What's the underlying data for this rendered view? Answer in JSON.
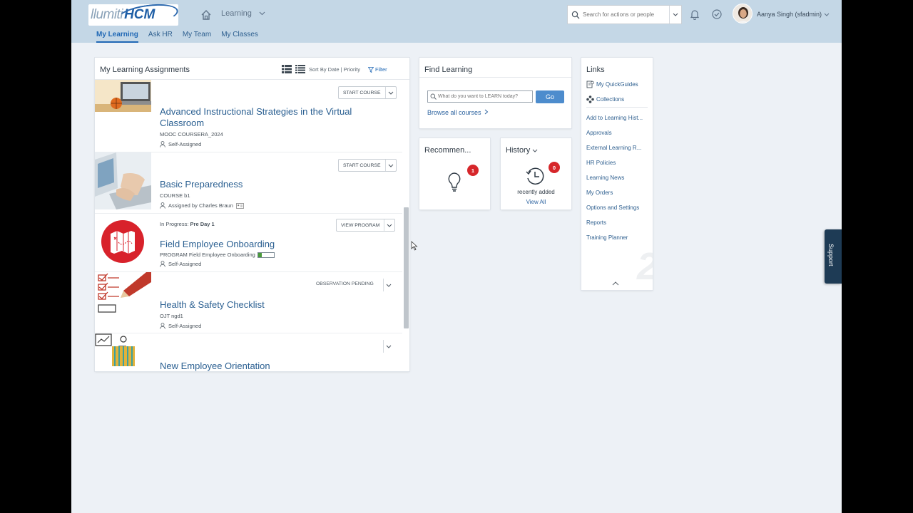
{
  "header": {
    "logo_text_a": "llumiti",
    "logo_text_b": "HCM",
    "module": "Learning",
    "search_placeholder": "Search for actions or people",
    "user_name": "Aanya Singh (sfadmin)",
    "subnav": [
      "My Learning",
      "Ask HR",
      "My Team",
      "My Classes"
    ]
  },
  "assignments": {
    "title": "My Learning Assignments",
    "sort_by_date": "Sort By Date",
    "sort_sep": " | ",
    "sort_priority": "Priority",
    "filter": "Filter",
    "items": [
      {
        "title": "Advanced Instructional Strategies in the Virtual Classroom",
        "meta": "MOOC COURSERA_2024",
        "assigned": "Self-Assigned",
        "action": "START COURSE"
      },
      {
        "title": "Basic Preparedness",
        "meta": "COURSE b1",
        "assigned": "Assigned by Charles Braun",
        "action": "START COURSE"
      },
      {
        "progress_label": "In Progress:",
        "progress_value": "Pre Day 1",
        "title": "Field Employee Onboarding",
        "meta": "PROGRAM Field Employee Onboarding",
        "progress_fraction": 0.25,
        "assigned": "Self-Assigned",
        "action": "VIEW PROGRAM"
      },
      {
        "title": "Health & Safety Checklist",
        "meta": "OJT ngd1",
        "assigned": "Self-Assigned",
        "status": "OBSERVATION PENDING"
      },
      {
        "title": "New Employee Orientation"
      }
    ]
  },
  "find_learning": {
    "title": "Find Learning",
    "placeholder": "What do you want to LEARN today?",
    "go": "Go",
    "browse": "Browse all courses"
  },
  "recommended": {
    "title": "Recommen...",
    "count": "1"
  },
  "history": {
    "title": "History",
    "count": "0",
    "caption": "recently added",
    "view_all": "View All"
  },
  "links": {
    "title": "Links",
    "top": [
      "My QuickGuides",
      "Collections"
    ],
    "items": [
      "Add to Learning Hist...",
      "Approvals",
      "External Learning R...",
      "HR Policies",
      "Learning News",
      "My Orders",
      "Options and Settings",
      "Reports",
      "Training Planner"
    ]
  },
  "support": "Support",
  "colors": {
    "brand": "#2068b5",
    "shell": "#c4d7e6",
    "badge": "#d6262a"
  }
}
